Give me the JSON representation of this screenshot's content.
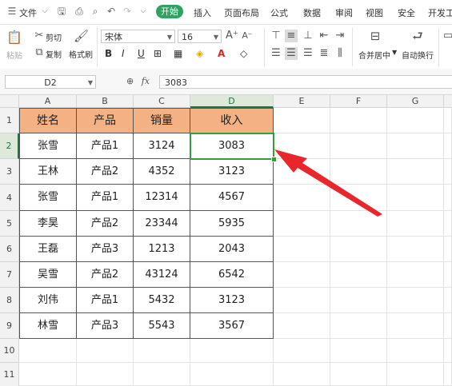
{
  "menubar": {
    "file_label": "文件",
    "start_label": "开始",
    "tabs": [
      "插入",
      "页面布局",
      "公式",
      "数据",
      "审阅",
      "视图",
      "安全",
      "开发工"
    ]
  },
  "ribbon": {
    "paste_label": "粘贴",
    "cut_label": "剪切",
    "copy_label": "复制",
    "format_painter_label": "格式刷",
    "font_name": "宋体",
    "font_size": "16",
    "bold": "B",
    "italic": "I",
    "underline": "U",
    "merge_center_label": "合并居中",
    "wrap_text_label": "自动换行"
  },
  "formula_bar": {
    "name_box": "D2",
    "fx_label": "fx",
    "formula_value": "3083"
  },
  "sheet": {
    "columns": [
      "A",
      "B",
      "C",
      "D",
      "E",
      "F",
      "G"
    ],
    "rows": [
      "1",
      "2",
      "3",
      "4",
      "5",
      "6",
      "7",
      "8",
      "9",
      "10",
      "11"
    ],
    "active_cell": "D2",
    "header": [
      "姓名",
      "产品",
      "销量",
      "收入"
    ],
    "data": [
      [
        "张雪",
        "产品1",
        "3124",
        "3083"
      ],
      [
        "王林",
        "产品2",
        "4352",
        "3123"
      ],
      [
        "张雪",
        "产品1",
        "12314",
        "4567"
      ],
      [
        "李昊",
        "产品2",
        "23344",
        "5935"
      ],
      [
        "王磊",
        "产品3",
        "1213",
        "2043"
      ],
      [
        "吴雪",
        "产品2",
        "43124",
        "6542"
      ],
      [
        "刘伟",
        "产品1",
        "5432",
        "3123"
      ],
      [
        "林雪",
        "产品3",
        "5543",
        "3567"
      ]
    ]
  },
  "colors": {
    "header_fill": "#f4b183",
    "selection": "#3a9a3f",
    "arrow": "#e8262b",
    "start_tab": "#2ea360"
  }
}
